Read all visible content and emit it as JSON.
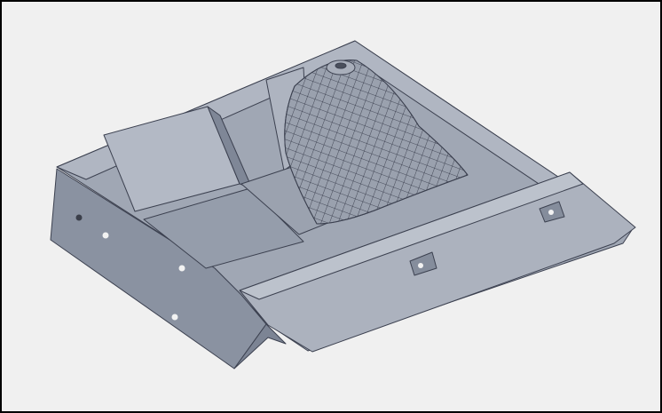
{
  "colors": {
    "background": "#f0f0f0",
    "border": "#000000",
    "surface_light": "#a3aab7",
    "surface_mid": "#8d95a4",
    "surface_dark": "#6e7585",
    "edge": "#3c4150",
    "hole": "#f2f2f2"
  }
}
